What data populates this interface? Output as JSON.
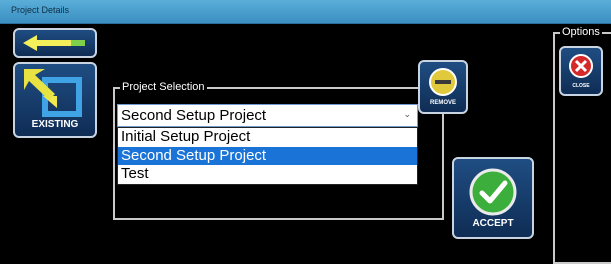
{
  "window": {
    "title": "Project Details"
  },
  "toolbar": {
    "back_icon": "arrow-left-icon",
    "existing_label": "EXISTING"
  },
  "project_selection": {
    "legend": "Project Selection",
    "selected_value": "Second Setup Project",
    "options": [
      {
        "label": "Initial Setup Project",
        "selected": false
      },
      {
        "label": "Second Setup Project",
        "selected": true
      },
      {
        "label": "Test",
        "selected": false
      }
    ]
  },
  "remove_button": {
    "label": "REMOVE",
    "icon": "minus-circle-icon"
  },
  "accept_button": {
    "label": "ACCEPT",
    "icon": "checkmark-circle-icon"
  },
  "options_panel": {
    "legend": "Options",
    "close_label": "CLOSE",
    "close_icon": "close-x-icon"
  },
  "colors": {
    "titlebar": "#4aa3d4",
    "selection": "#1a73d6",
    "button_bg": "#163d6b"
  }
}
